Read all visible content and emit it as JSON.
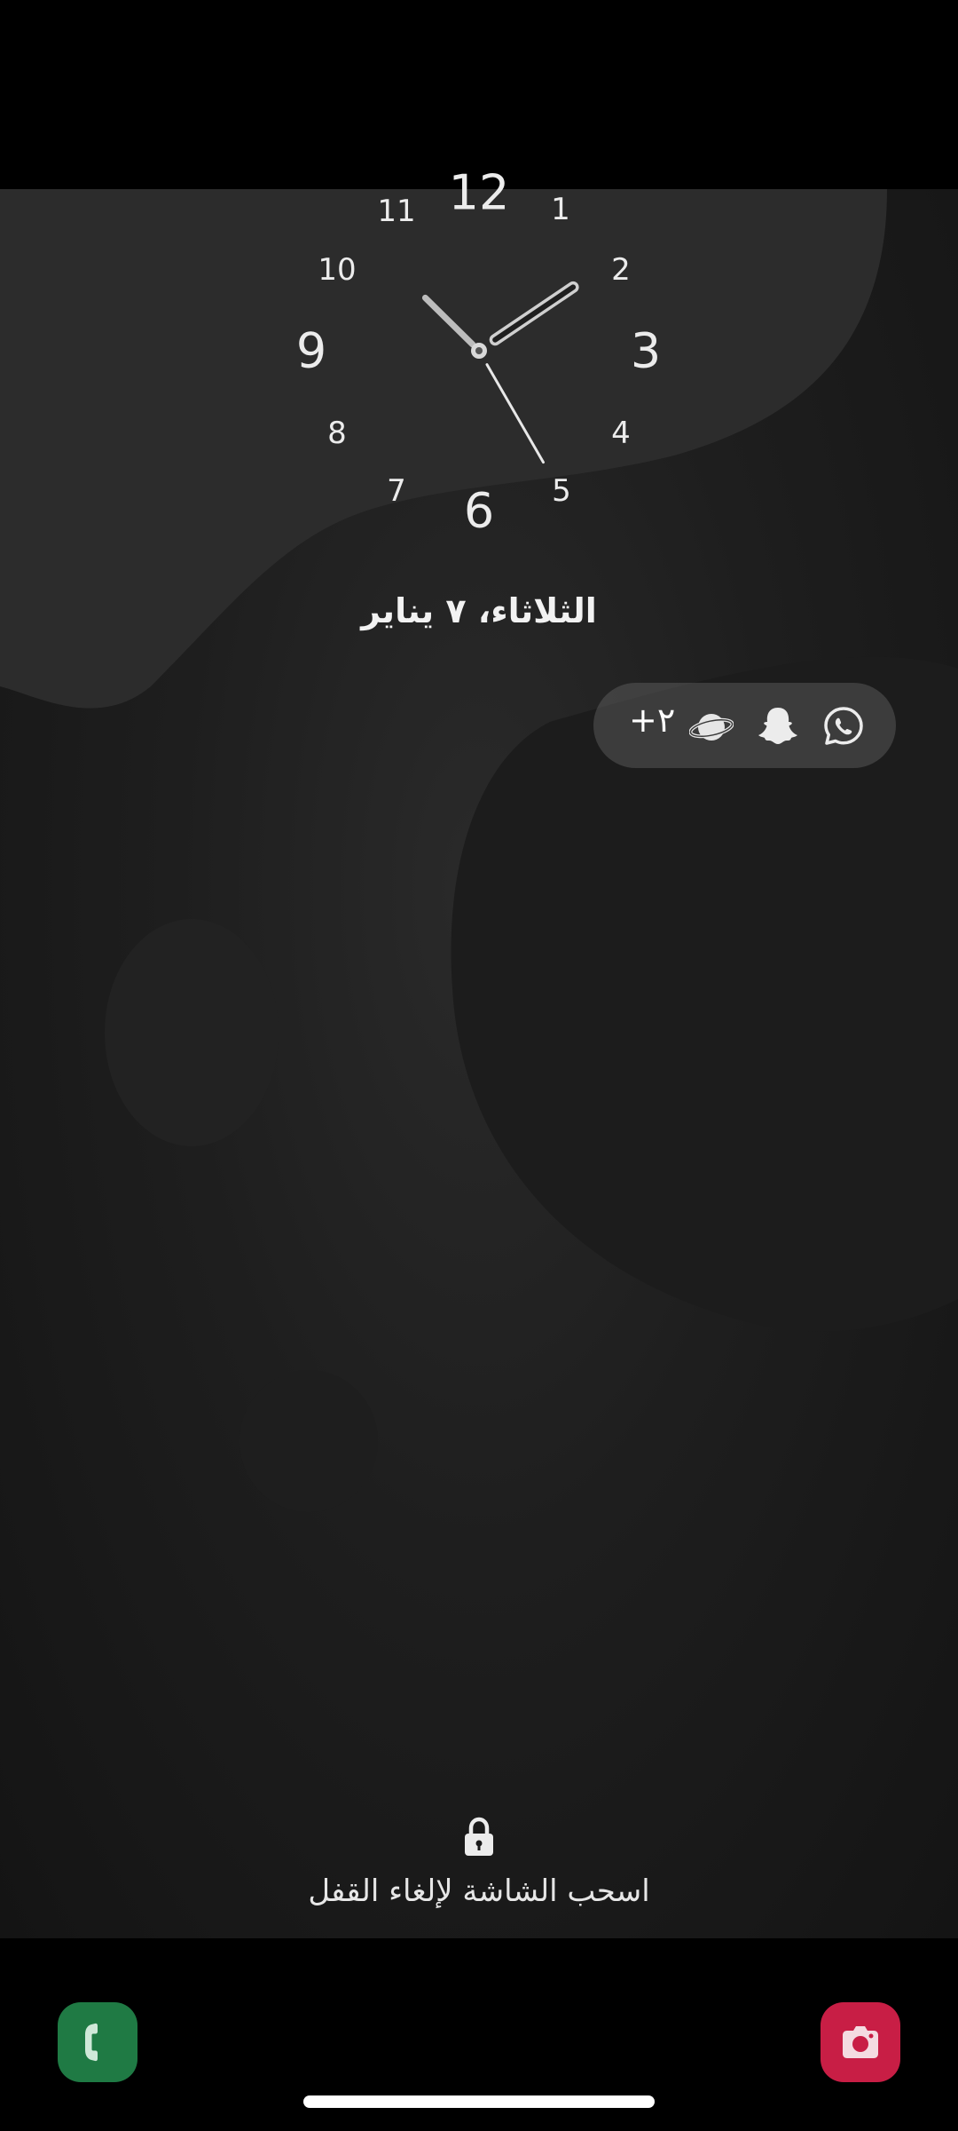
{
  "clock": {
    "numbers": {
      "n12": "12",
      "n1": "1",
      "n2": "2",
      "n3": "3",
      "n4": "4",
      "n5": "5",
      "n6": "6",
      "n7": "7",
      "n8": "8",
      "n9": "9",
      "n10": "10",
      "n11": "11"
    },
    "time": {
      "hour": 1,
      "minute": 52,
      "second": 25
    }
  },
  "date_text": "الثلاثاء، ٧ يناير",
  "notifications": {
    "more_count": "+٢",
    "icons": [
      "whatsapp-icon",
      "snapchat-icon",
      "samsung-internet-icon"
    ]
  },
  "lock": {
    "icon": "lock-icon",
    "hint": "اسحب الشاشة لإلغاء القفل"
  },
  "shortcuts": {
    "left": {
      "icon": "phone-icon",
      "color": "#1f7a44"
    },
    "right": {
      "icon": "camera-icon",
      "color": "#c81e45"
    }
  }
}
